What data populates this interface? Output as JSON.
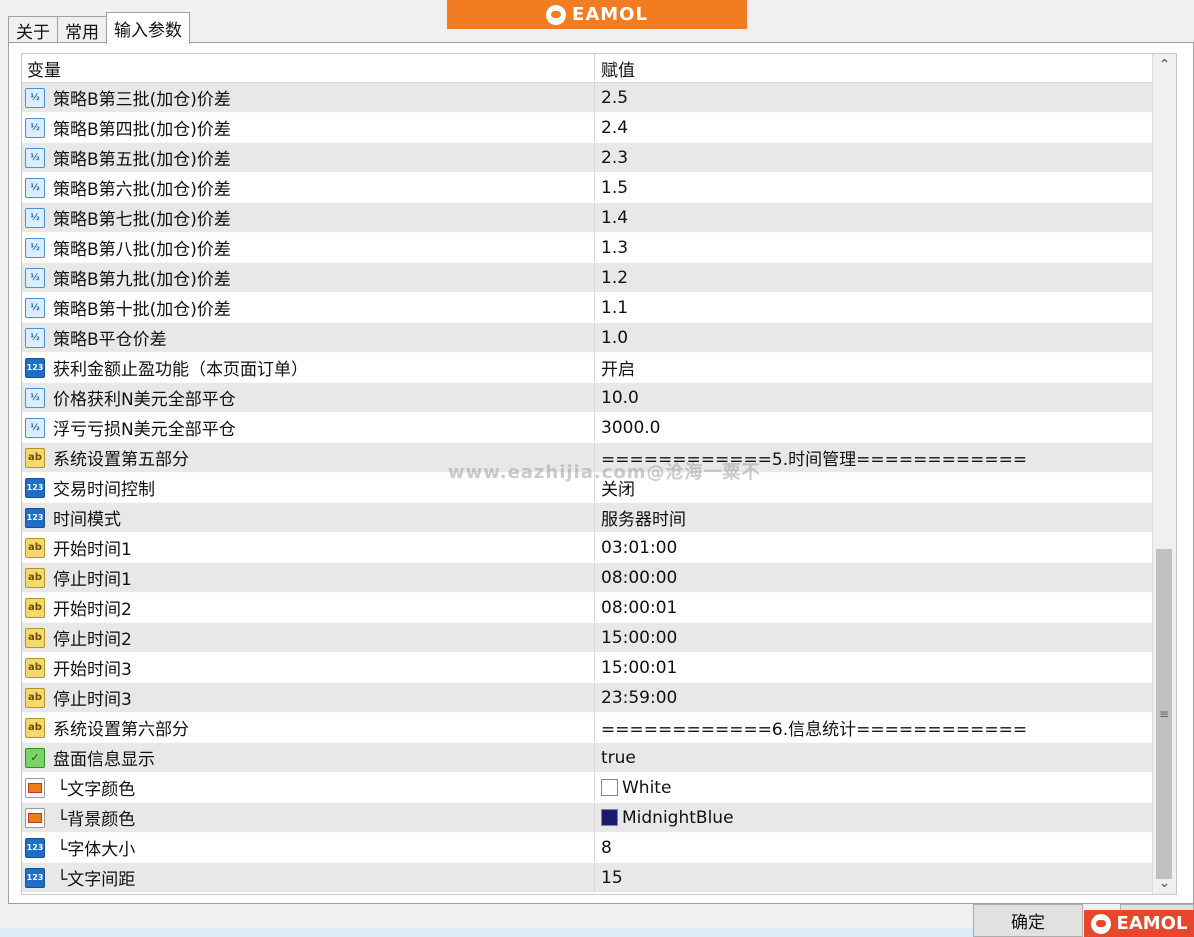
{
  "tabs": [
    "关于",
    "常用",
    "输入参数"
  ],
  "logo_text": "EAMOL",
  "watermark": "www.eazhijia.com@沧海一粟不",
  "header": {
    "name": "变量",
    "value": "赋值"
  },
  "rows": [
    {
      "icon": "double-icon",
      "name": "策略B第三批(加仓)价差",
      "value": "2.5"
    },
    {
      "icon": "double-icon",
      "name": "策略B第四批(加仓)价差",
      "value": "2.4"
    },
    {
      "icon": "double-icon",
      "name": "策略B第五批(加仓)价差",
      "value": "2.3"
    },
    {
      "icon": "double-icon",
      "name": "策略B第六批(加仓)价差",
      "value": "1.5"
    },
    {
      "icon": "double-icon",
      "name": "策略B第七批(加仓)价差",
      "value": "1.4"
    },
    {
      "icon": "double-icon",
      "name": "策略B第八批(加仓)价差",
      "value": "1.3"
    },
    {
      "icon": "double-icon",
      "name": "策略B第九批(加仓)价差",
      "value": "1.2"
    },
    {
      "icon": "double-icon",
      "name": "策略B第十批(加仓)价差",
      "value": "1.1"
    },
    {
      "icon": "double-icon",
      "name": "策略B平仓价差",
      "value": "1.0"
    },
    {
      "icon": "integer-icon",
      "name": "获利金额止盈功能（本页面订单）",
      "value": "开启"
    },
    {
      "icon": "double-icon",
      "name": "价格获利N美元全部平仓",
      "value": "10.0"
    },
    {
      "icon": "double-icon",
      "name": "浮亏亏损N美元全部平仓",
      "value": "3000.0"
    },
    {
      "icon": "string-icon",
      "name": "系统设置第五部分",
      "value": "============5.时间管理============"
    },
    {
      "icon": "integer-icon",
      "name": "交易时间控制",
      "value": "关闭"
    },
    {
      "icon": "integer-icon",
      "name": "时间模式",
      "value": "服务器时间"
    },
    {
      "icon": "string-icon",
      "name": "开始时间1",
      "value": "03:01:00"
    },
    {
      "icon": "string-icon",
      "name": "停止时间1",
      "value": "08:00:00"
    },
    {
      "icon": "string-icon",
      "name": "开始时间2",
      "value": "08:00:01"
    },
    {
      "icon": "string-icon",
      "name": "停止时间2",
      "value": "15:00:00"
    },
    {
      "icon": "string-icon",
      "name": "开始时间3",
      "value": "15:00:01"
    },
    {
      "icon": "string-icon",
      "name": "停止时间3",
      "value": "23:59:00"
    },
    {
      "icon": "string-icon",
      "name": "系统设置第六部分",
      "value": "============6.信息统计============"
    },
    {
      "icon": "bool-icon",
      "name": "盘面信息显示",
      "value": "true"
    },
    {
      "icon": "color-icon",
      "name": "└文字颜色",
      "value": "White",
      "swatch": "#ffffff"
    },
    {
      "icon": "color-icon",
      "name": "└背景颜色",
      "value": "MidnightBlue",
      "swatch": "#191970"
    },
    {
      "icon": "integer-icon",
      "name": "└字体大小",
      "value": "8"
    },
    {
      "icon": "integer-icon",
      "name": "└文字间距",
      "value": "15"
    }
  ],
  "ok_label": "确定",
  "colors": {
    "logo_orange": "#f27c22",
    "logo_red": "#e8472b",
    "row_alt": "#e8e8e8"
  }
}
